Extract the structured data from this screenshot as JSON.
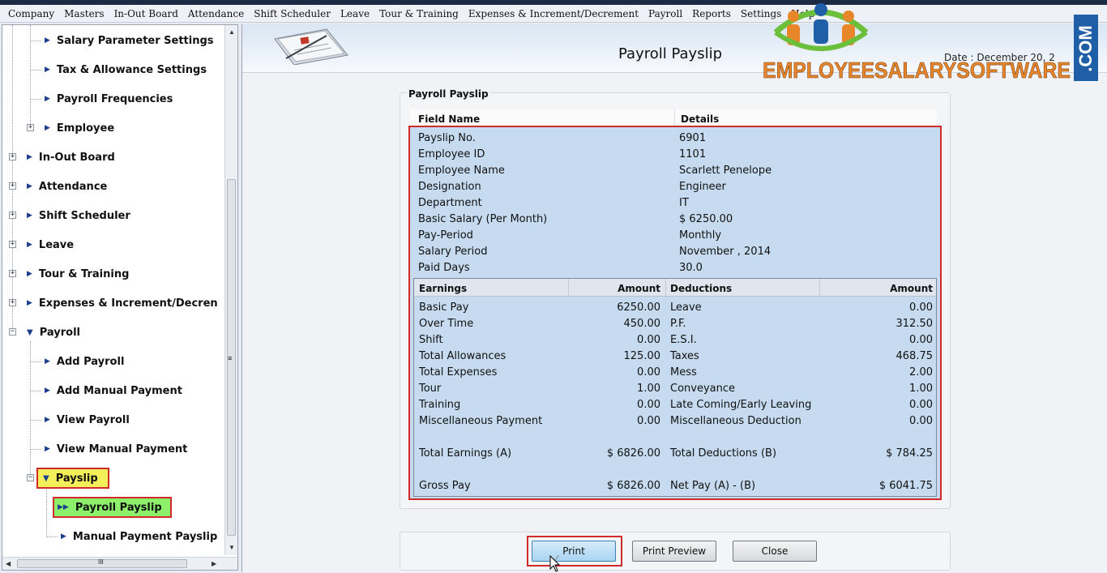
{
  "menubar": [
    "Company",
    "Masters",
    "In-Out Board",
    "Attendance",
    "Shift Scheduler",
    "Leave",
    "Tour & Training",
    "Expenses & Increment/Decrement",
    "Payroll",
    "Reports",
    "Settings",
    "Help"
  ],
  "sidebar": {
    "items": [
      {
        "label": "Salary Parameter Settings"
      },
      {
        "label": "Tax & Allowance Settings"
      },
      {
        "label": "Payroll Frequencies"
      },
      {
        "label": "Employee"
      },
      {
        "label": "In-Out Board"
      },
      {
        "label": "Attendance"
      },
      {
        "label": "Shift Scheduler"
      },
      {
        "label": "Leave"
      },
      {
        "label": "Tour & Training"
      },
      {
        "label": "Expenses & Increment/Decren"
      },
      {
        "label": "Payroll"
      },
      {
        "label": "Add Payroll"
      },
      {
        "label": "Add Manual Payment"
      },
      {
        "label": "View Payroll"
      },
      {
        "label": "View Manual Payment"
      },
      {
        "label": "Payslip"
      },
      {
        "label": "Payroll Payslip"
      },
      {
        "label": "Manual Payment Payslip"
      }
    ],
    "scroll_marker": "≡",
    "hscroll_marker": "III"
  },
  "header": {
    "title": "Payroll Payslip",
    "date": "Date :  December 20, 2",
    "logo_text": "EMPLOYEESALARYSOFTWARE",
    "logo_com": ".COM"
  },
  "payslip": {
    "legend": "Payroll Payslip",
    "col_field": "Field Name",
    "col_details": "Details",
    "fields": [
      {
        "name": "Payslip No.",
        "value": "6901"
      },
      {
        "name": "Employee ID",
        "value": "1101"
      },
      {
        "name": "Employee Name",
        "value": "Scarlett Penelope"
      },
      {
        "name": "Designation",
        "value": "Engineer"
      },
      {
        "name": "Department",
        "value": "IT"
      },
      {
        "name": "Basic Salary (Per Month)",
        "value": "$ 6250.00"
      },
      {
        "name": "Pay-Period",
        "value": "Monthly"
      },
      {
        "name": "Salary Period",
        "value": "November , 2014"
      },
      {
        "name": "Paid Days",
        "value": "30.0"
      }
    ],
    "earn_head": {
      "earnings": "Earnings",
      "amount1": "Amount",
      "deductions": "Deductions",
      "amount2": "Amount"
    },
    "rows": [
      {
        "earning": "Basic Pay",
        "ea": "6250.00",
        "deduction": "Leave",
        "da": "0.00"
      },
      {
        "earning": "Over Time",
        "ea": "450.00",
        "deduction": "P.F.",
        "da": "312.50"
      },
      {
        "earning": "Shift",
        "ea": "0.00",
        "deduction": "E.S.I.",
        "da": "0.00"
      },
      {
        "earning": "Total Allowances",
        "ea": "125.00",
        "deduction": "Taxes",
        "da": "468.75"
      },
      {
        "earning": "Total Expenses",
        "ea": "0.00",
        "deduction": "Mess",
        "da": "2.00"
      },
      {
        "earning": "Tour",
        "ea": "1.00",
        "deduction": "Conveyance",
        "da": "1.00"
      },
      {
        "earning": "Training",
        "ea": "0.00",
        "deduction": "Late Coming/Early Leaving",
        "da": "0.00"
      },
      {
        "earning": "Miscellaneous Payment",
        "ea": "0.00",
        "deduction": "Miscellaneous Deduction",
        "da": "0.00"
      }
    ],
    "totals": {
      "earning": "Total Earnings (A)",
      "ea": "$ 6826.00",
      "deduction": "Total Deductions (B)",
      "da": "$ 784.25"
    },
    "gross": {
      "earning": "Gross Pay",
      "ea": "$ 6826.00",
      "deduction": "Net Pay (A) - (B)",
      "da": "$ 6041.75"
    }
  },
  "buttons": {
    "print": "Print",
    "print_preview": "Print Preview",
    "close": "Close"
  }
}
